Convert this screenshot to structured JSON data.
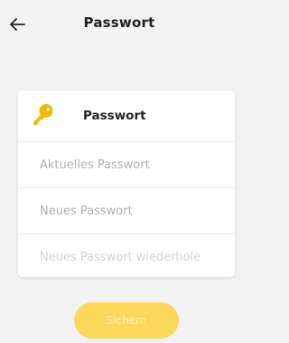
{
  "header": {
    "title": "Passwort",
    "back_icon": "arrow-left-icon"
  },
  "card": {
    "icon": "key-icon",
    "title": "Passwort",
    "fields": [
      {
        "placeholder": "Aktuelles Passwort",
        "value": ""
      },
      {
        "placeholder": "Neues Passwort",
        "value": ""
      },
      {
        "placeholder": "Neues Passwort wiederhole",
        "value": ""
      }
    ]
  },
  "actions": {
    "save_label": "Sichern",
    "save_enabled": false
  },
  "colors": {
    "background": "#f2f2f2",
    "accent": "#fbd85c",
    "key_icon": "#f5b800"
  }
}
